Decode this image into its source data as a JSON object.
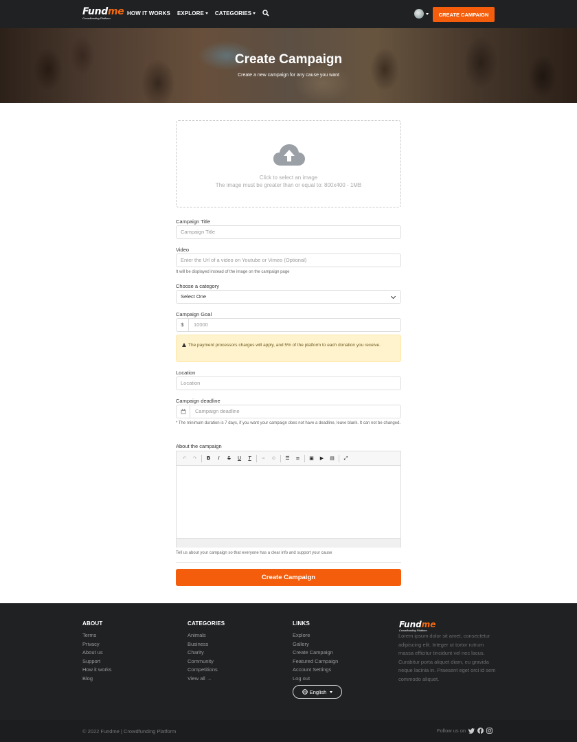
{
  "brand": {
    "name_a": "Fund",
    "name_b": "me",
    "tagline": "Crowdfunding Platform"
  },
  "nav": {
    "how_it_works": "HOW IT WORKS",
    "explore": "EXPLORE",
    "categories": "CATEGORIES",
    "cta": "CREATE CAMPAIGN"
  },
  "hero": {
    "title": "Create Campaign",
    "subtitle": "Create a new campaign for any cause you want"
  },
  "upload": {
    "line1": "Click to select an image",
    "line2": "The image must be greater than or equal to: 800x400 - 1MB"
  },
  "form": {
    "title_label": "Campaign Title",
    "title_placeholder": "Campaign Title",
    "video_label": "Video",
    "video_placeholder": "Enter the Url of a video on Youtube or Vimeo (Optional)",
    "video_help": "It will be displayed instead of the image on the campaign page",
    "category_label": "Choose a category",
    "category_value": "Select One",
    "goal_label": "Campaign Goal",
    "goal_currency": "$",
    "goal_placeholder": "10000",
    "fee_notice": "The payment processors charges will apply, and 5% of the platform to each donation you receive.",
    "location_label": "Location",
    "location_placeholder": "Location",
    "deadline_label": "Campaign deadline",
    "deadline_placeholder": "Campaign deadline",
    "deadline_help": "* The minimum duration is 7 days, if you want your campaign does not have a deadline, leave blank. It can not be changed.",
    "about_label": "About the campaign",
    "about_help": "Tell us about your campaign so that everyone has a clear info and support your cause",
    "submit": "Create Campaign"
  },
  "editor_toolbar": [
    {
      "name": "undo-icon",
      "glyph": "↶",
      "dim": true
    },
    {
      "name": "redo-icon",
      "glyph": "↷",
      "dim": true
    },
    {
      "name": "bold-icon",
      "glyph": "B"
    },
    {
      "name": "italic-icon",
      "glyph": "I"
    },
    {
      "name": "strikethrough-icon",
      "glyph": "S"
    },
    {
      "name": "underline-icon",
      "glyph": "U"
    },
    {
      "name": "clear-format-icon",
      "glyph": "T"
    },
    {
      "name": "link-icon",
      "glyph": "∞",
      "dim": true
    },
    {
      "name": "unlink-icon",
      "glyph": "⊘",
      "dim": true
    },
    {
      "name": "bullet-list-icon",
      "glyph": "☰"
    },
    {
      "name": "numbered-list-icon",
      "glyph": "≡"
    },
    {
      "name": "image-icon",
      "glyph": "▣"
    },
    {
      "name": "video-icon",
      "glyph": "▶"
    },
    {
      "name": "embed-icon",
      "glyph": "▤"
    },
    {
      "name": "fullscreen-icon",
      "glyph": "⤢"
    }
  ],
  "footer": {
    "about": {
      "heading": "ABOUT",
      "links": [
        "Terms",
        "Privacy",
        "About us",
        "Support",
        "How it works",
        "Blog"
      ]
    },
    "categories": {
      "heading": "CATEGORIES",
      "links": [
        "Animals",
        "Business",
        "Charity",
        "Community",
        "Competitions",
        "View all →"
      ]
    },
    "links": {
      "heading": "LINKS",
      "links": [
        "Explore",
        "Gallery",
        "Create Campaign",
        "Featured Campaign",
        "Account Settings",
        "Log out"
      ]
    },
    "language": "English",
    "description": "Lorem ipsum dolor sit amet, consectetur adipiscing elit. Integer ut tortor rutrum massa efficitur tincidunt vel nec lacus. Curabitur porta aliquet diam, eu gravida neque lacinia in. Praesent eget orci id sem commodo aliquet.",
    "copyright": "© 2022 Fundme | Crowdfunding Platform",
    "follow": "Follow us on"
  },
  "colors": {
    "accent": "#f45d0b",
    "dark": "#1f2123",
    "warning_bg": "#fff3cd"
  }
}
